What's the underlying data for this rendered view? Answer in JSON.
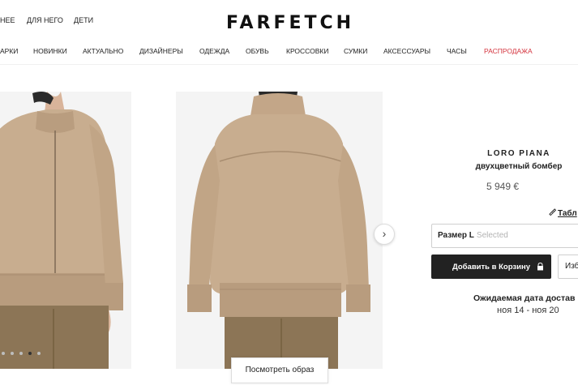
{
  "header": {
    "gender_nav": [
      "НЕЕ",
      "ДЛЯ НЕГО",
      "ДЕТИ"
    ],
    "logo": "FARFETCH"
  },
  "categories": [
    {
      "label": "АРКИ",
      "sale": false
    },
    {
      "label": "НОВИНКИ",
      "sale": false
    },
    {
      "label": "АКТУАЛЬНО",
      "sale": false
    },
    {
      "label": "ДИЗАЙНЕРЫ",
      "sale": false
    },
    {
      "label": "ОДЕЖДА",
      "sale": false
    },
    {
      "label": "ОБУВЬ",
      "sale": false
    },
    {
      "label": "КРОССОВКИ",
      "sale": false
    },
    {
      "label": "СУМКИ",
      "sale": false
    },
    {
      "label": "АКСЕССУАРЫ",
      "sale": false
    },
    {
      "label": "ЧАСЫ",
      "sale": false
    },
    {
      "label": "РАСПРОДАЖА",
      "sale": true
    }
  ],
  "gallery": {
    "dots_total": 5,
    "active_dot": 3,
    "next_icon": "chevron-right-icon",
    "look_button": "Посмотреть образ"
  },
  "product": {
    "brand": "LORO PIANA",
    "name": "двухцветный бомбер",
    "price": "5 949 €",
    "size_guide_icon": "ruler-icon",
    "size_guide_label": "Табл",
    "size_label": "Размер L",
    "size_state": "Selected",
    "add_to_bag": "Добавить в Корзину",
    "add_to_bag_icon": "lock-icon",
    "wishlist": "Изб",
    "delivery_title": "Ожидаемая дата достав",
    "delivery_dates": "ноя 14 - ноя 20"
  },
  "colors": {
    "sale": "#d4343e",
    "button_bg": "#222222",
    "jacket": "#c8ad8f",
    "trousers": "#8c7556",
    "photo_bg": "#f4f4f4"
  }
}
